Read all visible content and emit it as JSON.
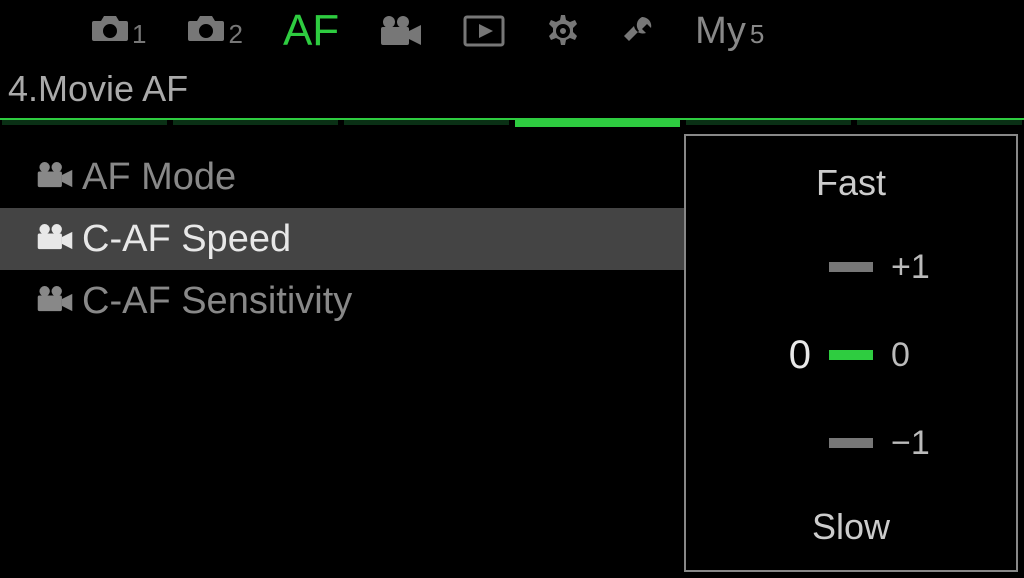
{
  "tabs": {
    "cam1_sub": "1",
    "cam2_sub": "2",
    "af_label": "AF",
    "my_label": "My",
    "my_sup": "5"
  },
  "section_title": "4.Movie AF",
  "subtabs": {
    "count": 6,
    "active_index": 3
  },
  "menu": {
    "items": [
      {
        "label": "AF Mode"
      },
      {
        "label": "C-AF Speed"
      },
      {
        "label": "C-AF Sensitivity"
      }
    ],
    "selected_index": 1
  },
  "slider": {
    "top_label": "Fast",
    "bottom_label": "Slow",
    "current_value": "0",
    "ticks": [
      {
        "label": "+1"
      },
      {
        "label": "0"
      },
      {
        "label": "−1"
      }
    ],
    "active_tick_index": 1
  }
}
